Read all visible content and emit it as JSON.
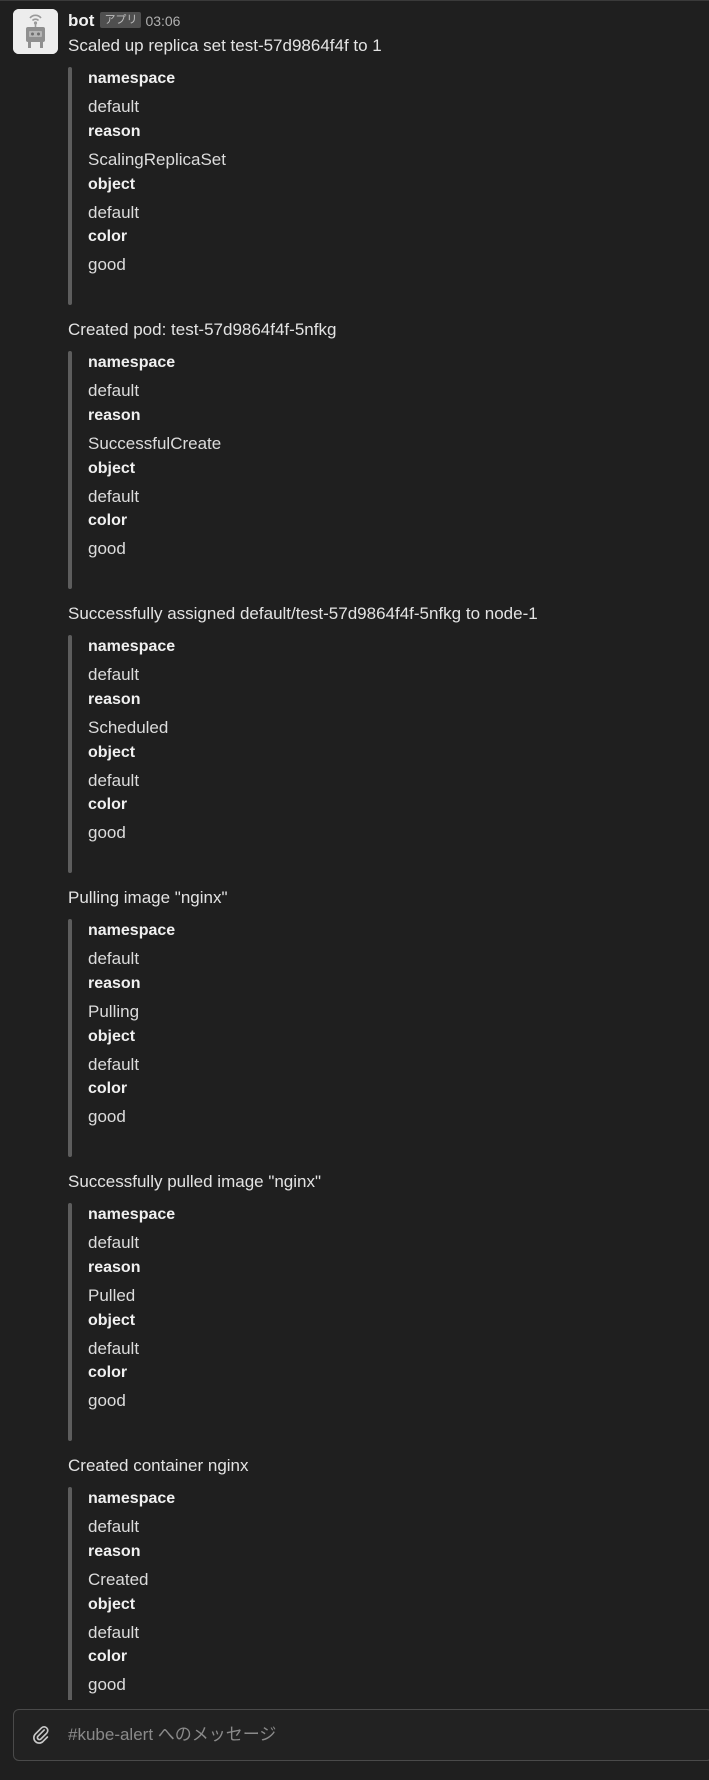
{
  "message": {
    "sender": "bot",
    "app_badge": "アプリ",
    "timestamp": "03:06"
  },
  "events": [
    {
      "title": "Scaled up replica set test-57d9864f4f to 1",
      "fields": [
        {
          "label": "namespace",
          "value": "default"
        },
        {
          "label": "reason",
          "value": "ScalingReplicaSet"
        },
        {
          "label": "object",
          "value": "default"
        },
        {
          "label": "color",
          "value": "good"
        }
      ]
    },
    {
      "title": "Created pod: test-57d9864f4f-5nfkg",
      "fields": [
        {
          "label": "namespace",
          "value": "default"
        },
        {
          "label": "reason",
          "value": "SuccessfulCreate"
        },
        {
          "label": "object",
          "value": "default"
        },
        {
          "label": "color",
          "value": "good"
        }
      ]
    },
    {
      "title": "Successfully assigned default/test-57d9864f4f-5nfkg to node-1",
      "fields": [
        {
          "label": "namespace",
          "value": "default"
        },
        {
          "label": "reason",
          "value": "Scheduled"
        },
        {
          "label": "object",
          "value": "default"
        },
        {
          "label": "color",
          "value": "good"
        }
      ]
    },
    {
      "title": "Pulling image \"nginx\"",
      "fields": [
        {
          "label": "namespace",
          "value": "default"
        },
        {
          "label": "reason",
          "value": "Pulling"
        },
        {
          "label": "object",
          "value": "default"
        },
        {
          "label": "color",
          "value": "good"
        }
      ]
    },
    {
      "title": "Successfully pulled image \"nginx\"",
      "fields": [
        {
          "label": "namespace",
          "value": "default"
        },
        {
          "label": "reason",
          "value": "Pulled"
        },
        {
          "label": "object",
          "value": "default"
        },
        {
          "label": "color",
          "value": "good"
        }
      ]
    },
    {
      "title": "Created container nginx",
      "fields": [
        {
          "label": "namespace",
          "value": "default"
        },
        {
          "label": "reason",
          "value": "Created"
        },
        {
          "label": "object",
          "value": "default"
        },
        {
          "label": "color",
          "value": "good"
        }
      ]
    }
  ],
  "composer": {
    "placeholder": "#kube-alert へのメッセージ",
    "value": "",
    "attach_icon": "paperclip-icon"
  },
  "colors": {
    "background": "#1f1f1f",
    "attachment_bar": "#5d5d5d",
    "text": "#e6e6e6",
    "muted_text": "#b0b0b0"
  }
}
